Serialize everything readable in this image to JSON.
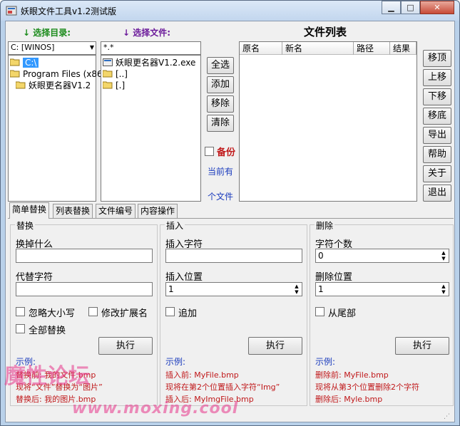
{
  "window": {
    "title": "妖眼文件工具v1.2测试版",
    "min_label": "▁",
    "max_label": "□",
    "close_label": "✕"
  },
  "left": {
    "dir_label": "选择目录:",
    "file_label": "选择文件:",
    "arrow_green": "↓",
    "arrow_purple": "↓",
    "drive_value": "C: [WINOS]",
    "tree": [
      "C:\\",
      "Program Files (x86)",
      "妖眼更名器V1.2"
    ],
    "filter_value": "*.*",
    "files": [
      "妖眼更名器V1.2.exe",
      "[..]",
      "[.]"
    ]
  },
  "mid_buttons": {
    "select_all": "全选",
    "add": "添加",
    "remove": "移除",
    "clear": "清除",
    "backup_label": "备份",
    "count_text_1": "当前有",
    "count_text_2": "个文件"
  },
  "file_list": {
    "title": "文件列表",
    "columns": [
      "原名",
      "新名",
      "路径",
      "结果"
    ]
  },
  "right_buttons": [
    "移顶",
    "上移",
    "下移",
    "移底",
    "导出",
    "帮助",
    "关于",
    "退出"
  ],
  "tabs": [
    "简单替换",
    "列表替换",
    "文件编号",
    "内容操作"
  ],
  "replace": {
    "group_title": "替换",
    "find_label": "换掉什么",
    "find_value": "",
    "replace_label": "代替字符",
    "replace_value": "",
    "ignore_case_label": "忽略大小写",
    "modify_ext_label": "修改扩展名",
    "replace_all_label": "全部替换",
    "execute_label": "执行",
    "example_title": "示例:",
    "example_1": "替换前: 我的文件.bmp",
    "example_2": "现将“文件”替换为“图片”",
    "example_3": "替换后: 我的图片.bmp"
  },
  "insert": {
    "group_title": "插入",
    "char_label": "插入字符",
    "char_value": "",
    "pos_label": "插入位置",
    "pos_value": "1",
    "append_label": "追加",
    "execute_label": "执行",
    "example_title": "示例:",
    "example_1": "插入前: MyFile.bmp",
    "example_2": "现将在第2个位置插入字符“Img”",
    "example_3": "插入后: MyImgFile.bmp"
  },
  "delete": {
    "group_title": "删除",
    "count_label": "字符个数",
    "count_value": "0",
    "pos_label": "删除位置",
    "pos_value": "1",
    "from_end_label": "从尾部",
    "execute_label": "执行",
    "example_title": "示例:",
    "example_1": "删除前: MyFile.bmp",
    "example_2": "现将从第3个位置删除2个字符",
    "example_3": "删除后: Myle.bmp"
  },
  "watermark": {
    "logo_text": "魔性论坛",
    "url_text": "www.moxing.cool"
  },
  "colors": {
    "accent_green": "#1a8a1a",
    "accent_purple": "#6b1a9a",
    "accent_red": "#c0181a",
    "accent_blue": "#1a3bbd",
    "selection": "#3399ff",
    "watermark": "#e8358c"
  }
}
